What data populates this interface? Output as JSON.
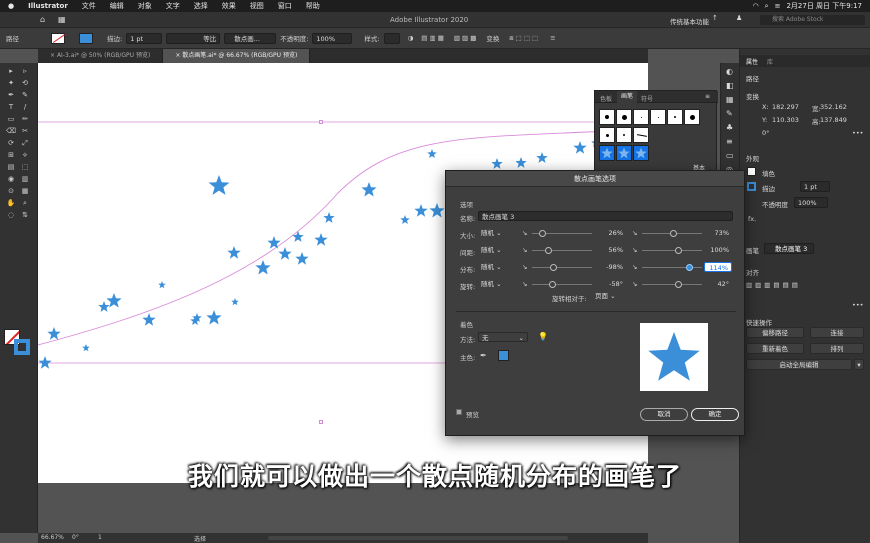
{
  "mac_menu": {
    "apple_icon": "apple-icon",
    "items": [
      "Illustrator",
      "文件",
      "编辑",
      "对象",
      "文字",
      "选择",
      "效果",
      "视图",
      "窗口",
      "帮助"
    ],
    "clock": "2月27日 周日 下午9:17"
  },
  "app_bar": {
    "title": "Adobe Illustrator 2020",
    "workspace": "传统基本功能",
    "search_placeholder": "搜索 Adobe Stock"
  },
  "control_bar": {
    "selection_label": "路径",
    "stroke_label": "描边:",
    "stroke_value": "1 pt",
    "profile_label": "等比",
    "brush_label": "散点画...",
    "opacity_label": "不透明度:",
    "opacity_value": "100%",
    "style_label": "样式:",
    "transform_label": "变换"
  },
  "tabs": [
    {
      "label": "AI-3.ai* @ 50% (RGB/GPU 预览)",
      "active": false
    },
    {
      "label": "散点画笔.ai* @ 66.67% (RGB/GPU 预览)",
      "active": true
    }
  ],
  "status": {
    "zoom": "66.67%",
    "rotate": "0°",
    "artboard": "1",
    "tool": "选择"
  },
  "brush_panel": {
    "tabs": [
      "色板",
      "画笔",
      "符号"
    ],
    "active_tab": "画笔",
    "basic_label": "基本"
  },
  "dialog": {
    "title": "散点画笔选项",
    "section_options": "选项",
    "name_label": "名称:",
    "name_value": "散点画笔 3",
    "rows": [
      {
        "label": "大小:",
        "mode": "随机",
        "v1": "26%",
        "v2": "73%",
        "k1": 0.17,
        "k2": 0.51
      },
      {
        "label": "间距:",
        "mode": "随机",
        "v1": "56%",
        "v2": "100%",
        "k1": 0.26,
        "k2": 0.6
      },
      {
        "label": "分布:",
        "mode": "随机",
        "v1": "-98%",
        "v2": "114%",
        "k1": 0.35,
        "k2": 0.78
      },
      {
        "label": "旋转:",
        "mode": "随机",
        "v1": "-58°",
        "v2": "42°",
        "k1": 0.34,
        "k2": 0.6
      }
    ],
    "rotation_relative_label": "旋转相对于:",
    "rotation_relative_value": "页面",
    "coloring_section": "着色",
    "method_label": "方法:",
    "method_value": "无",
    "key_color_label": "主色:",
    "key_color": "#3b8fd9",
    "preview_label": "预览",
    "cancel_label": "取消",
    "ok_label": "确定"
  },
  "properties": {
    "tabs": [
      "属性",
      "库"
    ],
    "section_path": "路径",
    "section_transform": "变换",
    "x_label": "X:",
    "x_value": "182.297",
    "y_label": "Y:",
    "y_value": "110.303",
    "w_label": "宽:",
    "w_value": "352.162",
    "h_label": "高:",
    "h_value": "137.849",
    "angle_value": "0°",
    "section_appearance": "外观",
    "fill_label": "填色",
    "stroke_label": "描边",
    "stroke_value": "1 pt",
    "opacity_label": "不透明度",
    "opacity_value": "100%",
    "fx_label": "fx.",
    "brush_label": "画笔",
    "brush_value": "散点画笔 3",
    "align_label": "对齐",
    "quick_actions": "快速操作",
    "btn_offset": "偏移路径",
    "btn_join": "连接",
    "btn_recolor": "重新着色",
    "btn_arrange": "排列",
    "btn_global_edit": "启动全局编辑"
  },
  "subtitle": "我们就可以做出一个散点随机分布的画笔了",
  "colors": {
    "star_blue": "#3b8fd9",
    "guide_pink": "#d98ad9",
    "panel_bg": "#323232"
  }
}
